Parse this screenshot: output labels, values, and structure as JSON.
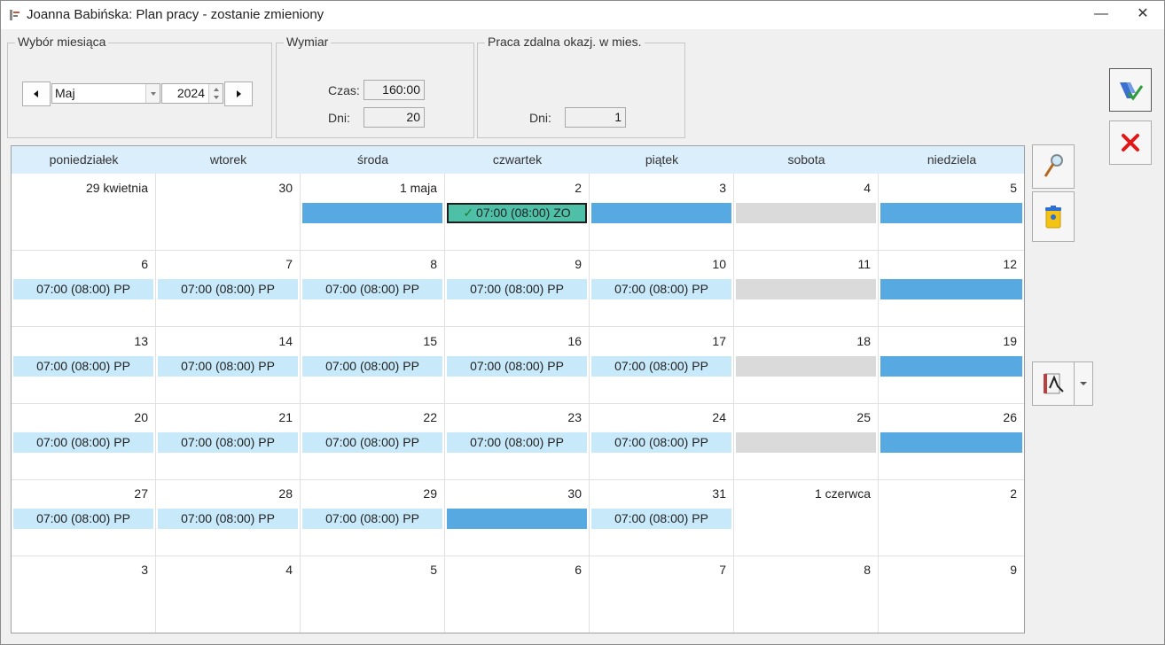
{
  "window": {
    "title": "Joanna Babińska: Plan pracy - zostanie zmieniony",
    "minimize": "—",
    "close": "✕"
  },
  "month_group": {
    "legend": "Wybór miesiąca",
    "month": "Maj",
    "year": "2024"
  },
  "wymiar_group": {
    "legend": "Wymiar",
    "czas_label": "Czas:",
    "czas_value": "160:00",
    "dni_label": "Dni:",
    "dni_value": "20"
  },
  "zdalna_group": {
    "legend": "Praca zdalna okazj. w mies.",
    "dni_label": "Dni:",
    "dni_value": "1"
  },
  "calendar": {
    "weekdays": [
      "poniedziałek",
      "wtorek",
      "środa",
      "czwartek",
      "piątek",
      "sobota",
      "niedziela"
    ],
    "weeks": [
      [
        {
          "day": "29 kwietnia",
          "bar": "none",
          "text": ""
        },
        {
          "day": "30",
          "bar": "none",
          "text": ""
        },
        {
          "day": "1 maja",
          "bar": "free",
          "text": ""
        },
        {
          "day": "2",
          "bar": "zo",
          "text": "07:00 (08:00) ZO"
        },
        {
          "day": "3",
          "bar": "free",
          "text": ""
        },
        {
          "day": "4",
          "bar": "sat",
          "text": ""
        },
        {
          "day": "5",
          "bar": "free",
          "text": ""
        }
      ],
      [
        {
          "day": "6",
          "bar": "pp",
          "text": "07:00 (08:00) PP"
        },
        {
          "day": "7",
          "bar": "pp",
          "text": "07:00 (08:00) PP"
        },
        {
          "day": "8",
          "bar": "pp",
          "text": "07:00 (08:00) PP"
        },
        {
          "day": "9",
          "bar": "pp",
          "text": "07:00 (08:00) PP"
        },
        {
          "day": "10",
          "bar": "pp",
          "text": "07:00 (08:00) PP"
        },
        {
          "day": "11",
          "bar": "sat",
          "text": ""
        },
        {
          "day": "12",
          "bar": "free",
          "text": ""
        }
      ],
      [
        {
          "day": "13",
          "bar": "pp",
          "text": "07:00 (08:00) PP"
        },
        {
          "day": "14",
          "bar": "pp",
          "text": "07:00 (08:00) PP"
        },
        {
          "day": "15",
          "bar": "pp",
          "text": "07:00 (08:00) PP"
        },
        {
          "day": "16",
          "bar": "pp",
          "text": "07:00 (08:00) PP"
        },
        {
          "day": "17",
          "bar": "pp",
          "text": "07:00 (08:00) PP"
        },
        {
          "day": "18",
          "bar": "sat",
          "text": ""
        },
        {
          "day": "19",
          "bar": "free",
          "text": ""
        }
      ],
      [
        {
          "day": "20",
          "bar": "pp",
          "text": "07:00 (08:00) PP"
        },
        {
          "day": "21",
          "bar": "pp",
          "text": "07:00 (08:00) PP"
        },
        {
          "day": "22",
          "bar": "pp",
          "text": "07:00 (08:00) PP"
        },
        {
          "day": "23",
          "bar": "pp",
          "text": "07:00 (08:00) PP"
        },
        {
          "day": "24",
          "bar": "pp",
          "text": "07:00 (08:00) PP"
        },
        {
          "day": "25",
          "bar": "sat",
          "text": ""
        },
        {
          "day": "26",
          "bar": "free",
          "text": ""
        }
      ],
      [
        {
          "day": "27",
          "bar": "pp",
          "text": "07:00 (08:00) PP"
        },
        {
          "day": "28",
          "bar": "pp",
          "text": "07:00 (08:00) PP"
        },
        {
          "day": "29",
          "bar": "pp",
          "text": "07:00 (08:00) PP"
        },
        {
          "day": "30",
          "bar": "free",
          "text": ""
        },
        {
          "day": "31",
          "bar": "pp",
          "text": "07:00 (08:00) PP"
        },
        {
          "day": "1 czerwca",
          "bar": "none",
          "text": ""
        },
        {
          "day": "2",
          "bar": "none",
          "text": ""
        }
      ],
      [
        {
          "day": "3",
          "bar": "none",
          "text": ""
        },
        {
          "day": "4",
          "bar": "none",
          "text": ""
        },
        {
          "day": "5",
          "bar": "none",
          "text": ""
        },
        {
          "day": "6",
          "bar": "none",
          "text": ""
        },
        {
          "day": "7",
          "bar": "none",
          "text": ""
        },
        {
          "day": "8",
          "bar": "none",
          "text": ""
        },
        {
          "day": "9",
          "bar": "none",
          "text": ""
        }
      ]
    ]
  },
  "colors": {
    "pp": "#c7e9fa",
    "free": "#57a9e2",
    "sat": "#dadada",
    "zo": "#4fc0a8",
    "header": "#dbeefb"
  },
  "icons": [
    "app-icon",
    "prev-month-icon",
    "next-month-icon",
    "save-icon",
    "cancel-icon",
    "magnifier-icon",
    "trash-bin-icon",
    "calendar-tool-icon",
    "dropdown-arrow-icon"
  ]
}
